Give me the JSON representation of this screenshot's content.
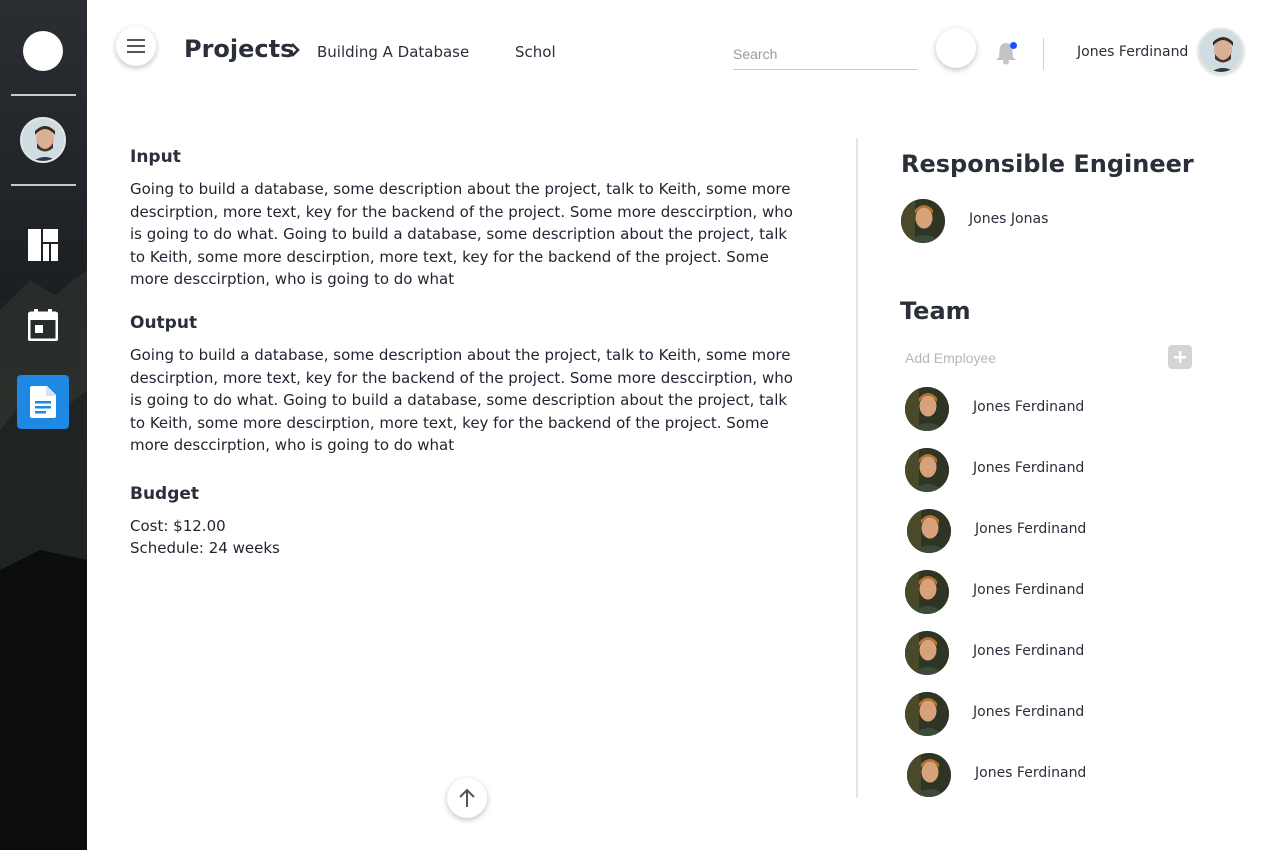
{
  "header": {
    "breadcrumb": {
      "title": "Projects",
      "items": [
        "Building A Database",
        "Schol"
      ]
    },
    "search_placeholder": "Search",
    "user_name": "Jones Ferdinand"
  },
  "sidebar": {
    "icons": [
      "logo-icon",
      "dashboard-icon",
      "calendar-icon",
      "document-icon"
    ],
    "active_item": "document",
    "accent_color": "#1e88e5"
  },
  "main": {
    "input": {
      "title": "Input",
      "text": "Going to build a database, some description about the project, talk to Keith, some more descirption, more text, key for the backend of the project. Some more desccirption, who is going to do what. Going to build a database, some description about the project, talk to Keith, some more descirption, more text, key for the backend of the project. Some more desccirption, who is going to do what"
    },
    "output": {
      "title": "Output",
      "text": "Going to build a database, some description about the project, talk to Keith, some more descirption, more text, key for the backend of the project. Some more desccirption, who is going to do what. Going to build a database, some description about the project, talk to Keith, some more descirption, more text, key for the backend of the project. Some more desccirption, who is going to do what"
    },
    "budget": {
      "title": "Budget",
      "cost": "Cost: $12.00",
      "schedule": "Schedule: 24 weeks"
    }
  },
  "right_panel": {
    "engineer_title": "Responsible Engineer",
    "engineer_name": "Jones Jonas",
    "team_title": "Team",
    "add_employee_placeholder": "Add Employee",
    "team_members": [
      "Jones Ferdinand",
      "Jones Ferdinand",
      "Jones Ferdinand",
      "Jones Ferdinand",
      "Jones Ferdinand",
      "Jones Ferdinand",
      "Jones Ferdinand"
    ]
  }
}
